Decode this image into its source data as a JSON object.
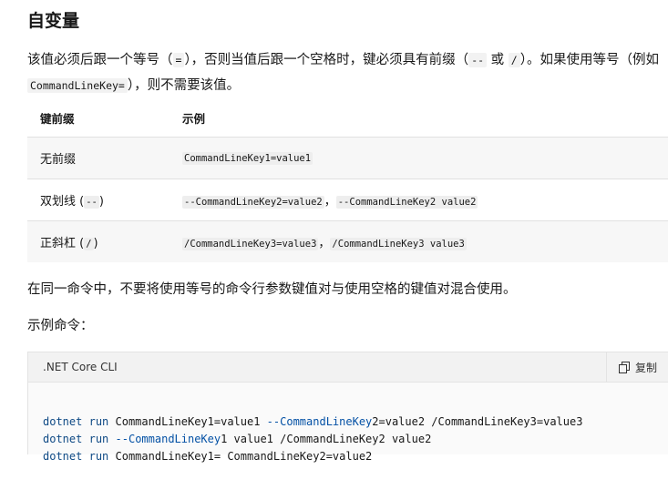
{
  "heading": "自变量",
  "intro": {
    "part1": "该值必须后跟一个等号（",
    "code_eq": "=",
    "part2": "），否则当值后跟一个空格时，键必须具有前缀（",
    "code_dash": "--",
    "part3": " 或 ",
    "code_slash": "/",
    "part4": "）。如果使用等号（例如 ",
    "code_example": "CommandLineKey=",
    "part5": "），则不需要该值。"
  },
  "table": {
    "headers": [
      "键前缀",
      "示例"
    ],
    "rows": [
      {
        "prefix": "无前缀",
        "prefix_code": "",
        "examples": [
          "CommandLineKey1=value1"
        ]
      },
      {
        "prefix": "双划线 (",
        "prefix_code": "--",
        "prefix_end": ")",
        "examples": [
          "--CommandLineKey2=value2",
          "--CommandLineKey2 value2"
        ]
      },
      {
        "prefix": "正斜杠 (",
        "prefix_code": "/",
        "prefix_end": ")",
        "examples": [
          "/CommandLineKey3=value3",
          "/CommandLineKey3 value3"
        ]
      }
    ],
    "separator": "，"
  },
  "para2": "在同一命令中，不要将使用等号的命令行参数键值对与使用空格的键值对混合使用。",
  "para3": "示例命令：",
  "codeblock": {
    "language": ".NET Core CLI",
    "copy_label": "复制",
    "copy_icon": "copy-icon",
    "lines": [
      [
        "dotnet",
        " ",
        "run",
        " CommandLineKey1=value1 ",
        "--CommandLineKey",
        "2=value2 /CommandLineKey3=value3"
      ],
      [
        "dotnet",
        " ",
        "run",
        " ",
        "--CommandLineKey",
        "1 value1 /CommandLineKey2 value2"
      ],
      [
        "dotnet",
        " ",
        "run",
        " CommandLineKey1= CommandLineKey2=value2",
        "",
        ""
      ]
    ]
  },
  "colors": {
    "keyword": "#0f4a85",
    "option": "#0451a5"
  }
}
